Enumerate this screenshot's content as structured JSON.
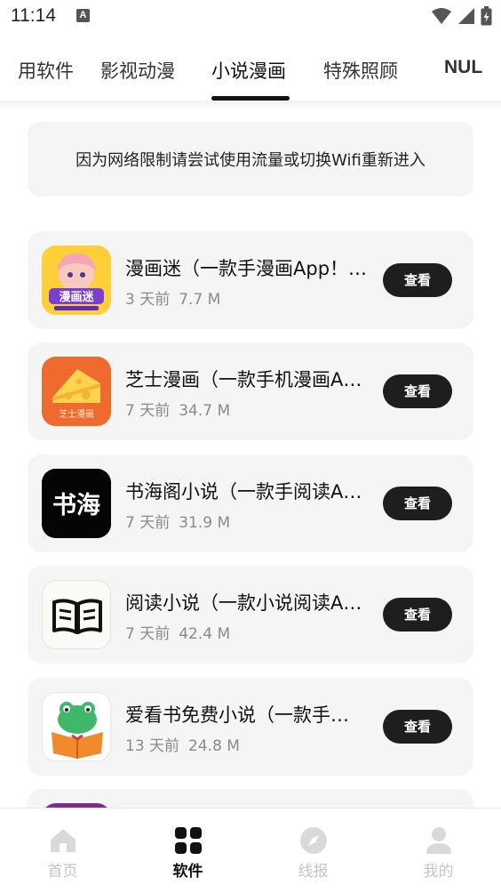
{
  "status_bar": {
    "time": "11:14",
    "notification_letter": "A"
  },
  "tabs": [
    {
      "label": "用软件",
      "active": false
    },
    {
      "label": "影视动漫",
      "active": false
    },
    {
      "label": "小说漫画",
      "active": true
    },
    {
      "label": "特殊照顾",
      "active": false
    },
    {
      "label": "NUL",
      "active": false
    }
  ],
  "notice": "因为网络限制请尝试使用流量或切换Wifi重新进入",
  "apps": [
    {
      "name": "漫画迷（一款手漫画App！…",
      "age": "3 天前",
      "size": "7.7 M",
      "button": "查看",
      "icon": "manhuami-icon",
      "icon_text": "漫画迷"
    },
    {
      "name": "芝士漫画（一款手机漫画A…",
      "age": "7 天前",
      "size": "34.7 M",
      "button": "查看",
      "icon": "cheese-icon",
      "icon_text": "芝士漫画"
    },
    {
      "name": "书海阁小说（一款手阅读A…",
      "age": "7 天前",
      "size": "31.9 M",
      "button": "查看",
      "icon": "shuhai-icon",
      "icon_text": "书海"
    },
    {
      "name": "阅读小说（一款小说阅读A…",
      "age": "7 天前",
      "size": "42.4 M",
      "button": "查看",
      "icon": "open-book-icon"
    },
    {
      "name": "爱看书免费小说（一款手…",
      "age": "13 天前",
      "size": "24.8 M",
      "button": "查看",
      "icon": "frog-book-icon"
    }
  ],
  "bottom_nav": [
    {
      "label": "首页",
      "icon": "home-icon",
      "active": false
    },
    {
      "label": "软件",
      "icon": "apps-grid-icon",
      "active": true
    },
    {
      "label": "线报",
      "icon": "compass-icon",
      "active": false
    },
    {
      "label": "我的",
      "icon": "user-icon",
      "active": false
    }
  ],
  "colors": {
    "accent": "#111111",
    "card_bg": "#f5f5f5",
    "button_bg": "#1e1e1e",
    "muted": "#8a8a8a",
    "nav_inactive": "#c4c4c4"
  }
}
